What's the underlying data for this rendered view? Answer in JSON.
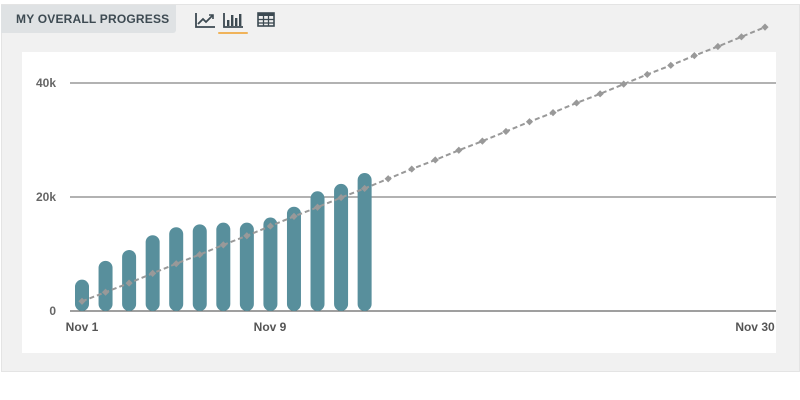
{
  "header": {
    "title": "MY OVERALL PROGRESS"
  },
  "view_switcher": {
    "active": "bar",
    "icons": [
      "line-chart-icon",
      "bar-chart-icon",
      "table-icon"
    ]
  },
  "colors": {
    "bar": "#588f9c",
    "projection": "#999999",
    "accent": "#f0b35a",
    "grid": "#666666",
    "header_bg": "#dfe2e4",
    "header_text": "#3d4a52"
  },
  "chart_data": {
    "type": "bar",
    "x_tick_labels": [
      "Nov 1",
      "Nov 9",
      "Nov 30"
    ],
    "y_tick_labels": [
      "0",
      "20k",
      "40k"
    ],
    "ylim": [
      0,
      50000
    ],
    "grid": true,
    "series": [
      {
        "kind": "bar",
        "x": [
          1,
          2,
          3,
          4,
          5,
          6,
          7,
          8,
          9,
          10,
          11,
          12,
          13
        ],
        "values": [
          5500,
          8800,
          10700,
          13300,
          14700,
          15200,
          15500,
          15500,
          16400,
          18300,
          21000,
          22300,
          24200
        ]
      },
      {
        "kind": "line",
        "style": "dashed",
        "marker": "diamond",
        "x": [
          1,
          2,
          3,
          4,
          5,
          6,
          7,
          8,
          9,
          10,
          11,
          12,
          13,
          14,
          15,
          16,
          17,
          18,
          19,
          20,
          21,
          22,
          23,
          24,
          25,
          26,
          27,
          28,
          29,
          30
        ],
        "values": [
          1700,
          3300,
          4900,
          6600,
          8300,
          9900,
          11600,
          13200,
          14900,
          16600,
          18200,
          19900,
          21500,
          23200,
          24900,
          26500,
          28200,
          29800,
          31500,
          33200,
          34800,
          36500,
          38100,
          39800,
          41500,
          43100,
          44800,
          46400,
          48100,
          49800
        ]
      }
    ]
  }
}
